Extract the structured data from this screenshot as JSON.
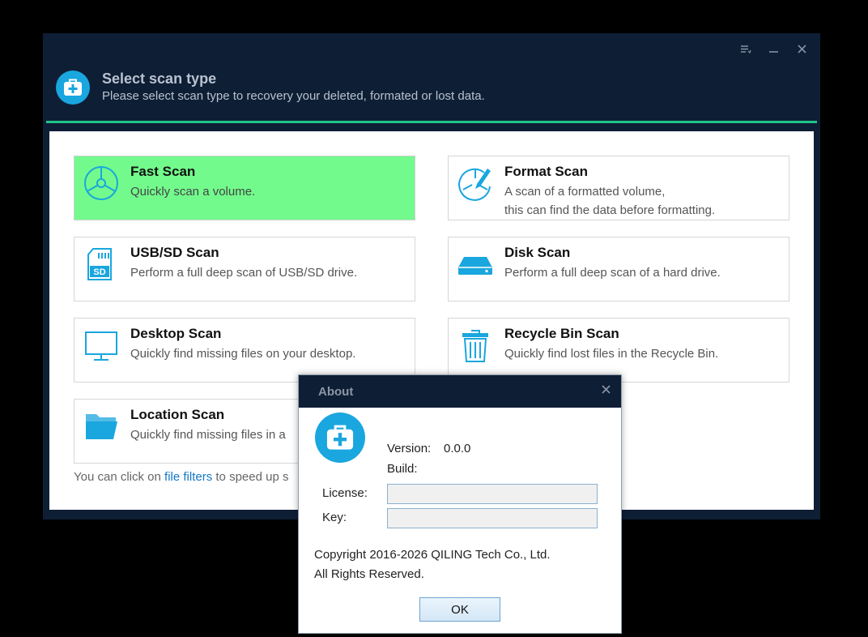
{
  "window": {
    "title": "Select scan type",
    "subtitle": "Please select scan type to recovery your deleted, formated or lost data.",
    "controls": {
      "menu_icon": "menu-icon",
      "minimize_icon": "minimize-icon",
      "close_icon": "close-icon"
    }
  },
  "cards": [
    {
      "title": "Fast Scan",
      "desc": "Quickly scan a volume.",
      "icon": "pie-scan-icon",
      "selected": true
    },
    {
      "title": "Format Scan",
      "desc": "A scan of a formatted volume,\nthis can find the data before formatting.",
      "icon": "format-scan-icon",
      "selected": false
    },
    {
      "title": "USB/SD Scan",
      "desc": "Perform a full deep scan of USB/SD drive.",
      "icon": "sd-card-icon",
      "selected": false
    },
    {
      "title": "Disk Scan",
      "desc": "Perform a full deep scan of a hard drive.",
      "icon": "hard-drive-icon",
      "selected": false
    },
    {
      "title": "Desktop Scan",
      "desc": "Quickly find missing files on your desktop.",
      "icon": "monitor-icon",
      "selected": false
    },
    {
      "title": "Recycle Bin Scan",
      "desc": "Quickly find lost files in the Recycle Bin.",
      "icon": "recycle-bin-icon",
      "selected": false
    },
    {
      "title": "Location Scan",
      "desc": "Quickly find missing files in a",
      "icon": "folder-icon",
      "selected": false
    }
  ],
  "hint": {
    "prefix": "You can click on ",
    "link": "file filters",
    "suffix": " to speed up s"
  },
  "about": {
    "title": "About",
    "version_label": "Version:",
    "version_value": "0.0.0",
    "build_label": "Build:",
    "license_label": "License:",
    "license_value": "",
    "key_label": "Key:",
    "key_value": "",
    "copyright_line1": "Copyright 2016-2026 QILING Tech Co., Ltd.",
    "copyright_line2": "All Rights Reserved.",
    "ok_label": "OK"
  },
  "colors": {
    "accent": "#1aa6de",
    "selected_card": "#72fb8c",
    "header_bg": "#0e1e35",
    "divider": "#1ec58a",
    "link": "#1477c5"
  }
}
